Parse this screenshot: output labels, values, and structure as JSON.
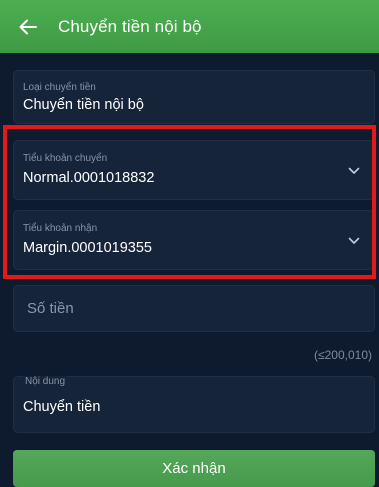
{
  "header": {
    "title": "Chuyển tiền nội bộ",
    "back_icon": "arrow-left-icon"
  },
  "form": {
    "transfer_type": {
      "label": "Loại chuyển tiền",
      "value": "Chuyển tiền nội bộ"
    },
    "source_account": {
      "label": "Tiểu khoản chuyển",
      "value": "Normal.0001018832",
      "icon": "chevron-down-icon"
    },
    "target_account": {
      "label": "Tiểu khoản nhận",
      "value": "Margin.0001019355",
      "icon": "chevron-down-icon"
    },
    "amount": {
      "placeholder": "Số tiền"
    },
    "limit_text": "(≤200,010)",
    "content": {
      "label": "Nội dung",
      "value": "Chuyển tiền"
    }
  },
  "actions": {
    "confirm_label": "Xác nhận"
  },
  "colors": {
    "accent": "#4caf50",
    "background": "#0e1b2e",
    "highlight": "#e21a1a"
  }
}
